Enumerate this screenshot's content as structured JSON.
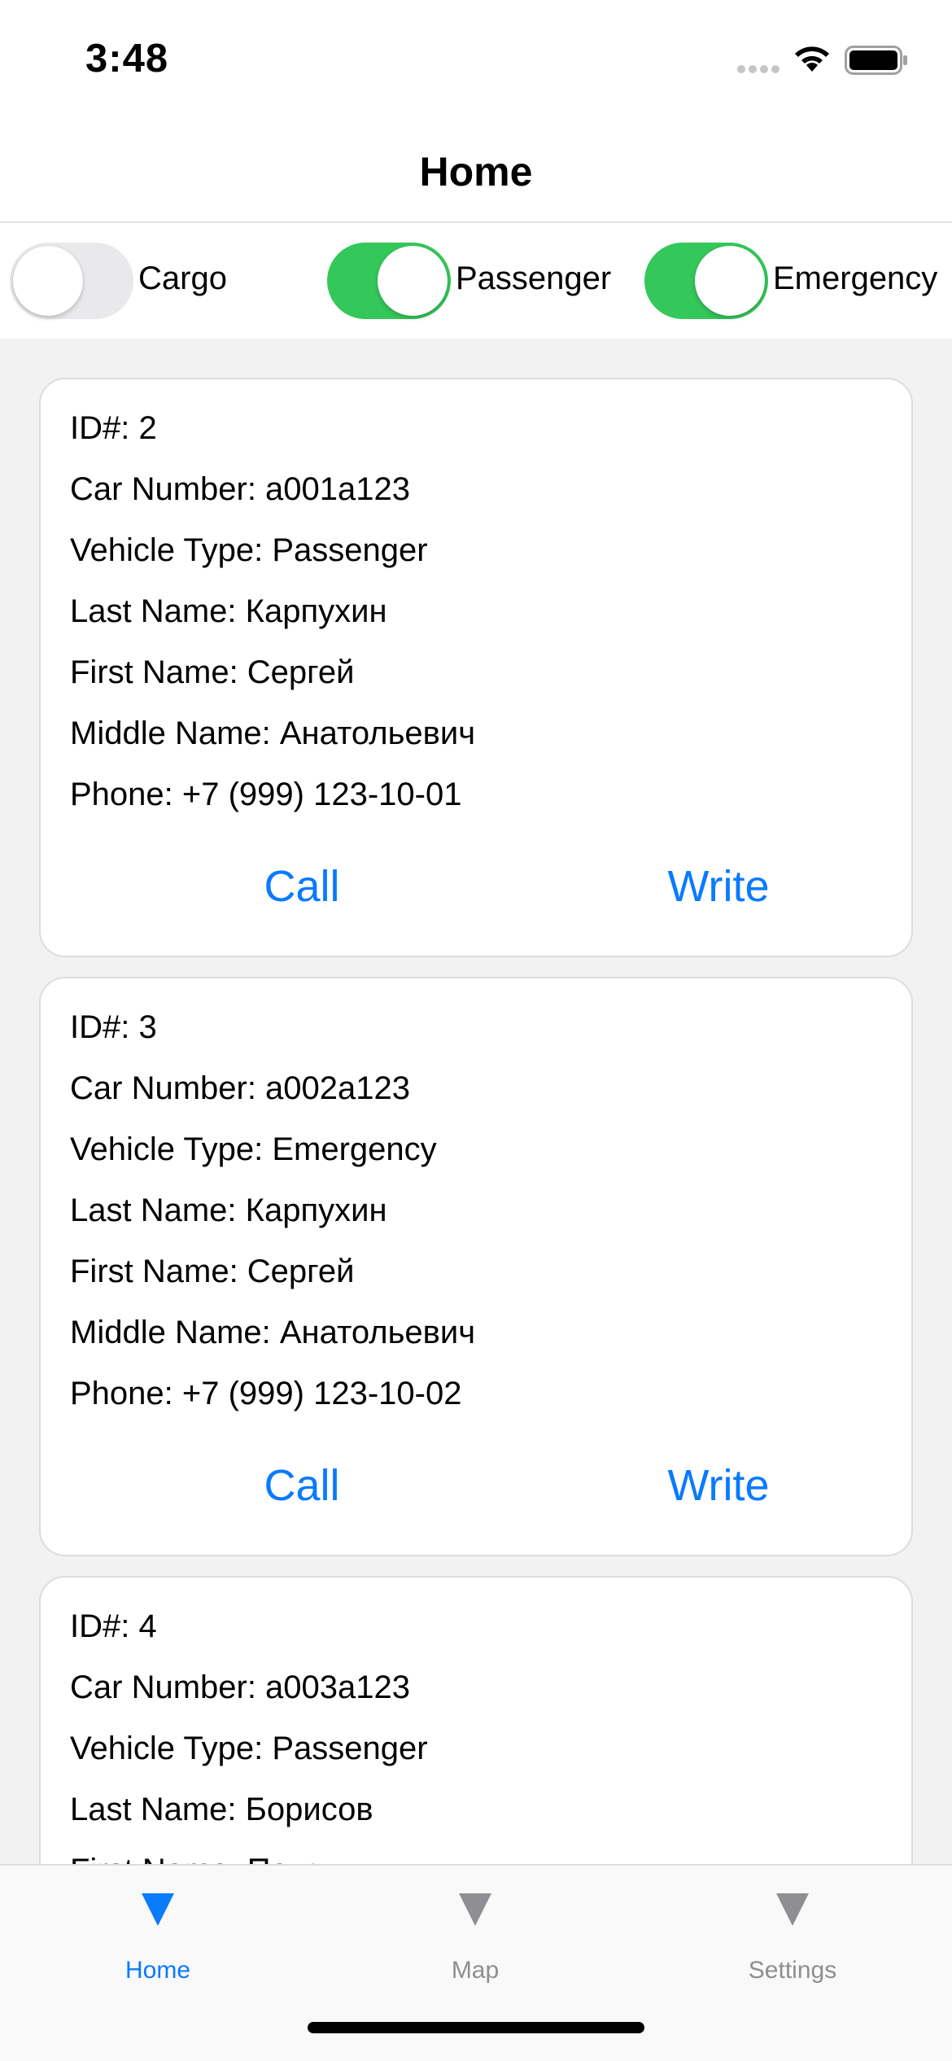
{
  "status_bar": {
    "time": "3:48"
  },
  "navbar": {
    "title": "Home"
  },
  "filters": [
    {
      "label": "Cargo",
      "on": false
    },
    {
      "label": "Passenger",
      "on": true
    },
    {
      "label": "Emergency",
      "on": true
    }
  ],
  "cards": [
    {
      "id": "ID#: 2",
      "car_number": "Car Number: a001a123",
      "vehicle_type": "Vehicle Type: Passenger",
      "last_name": "Last Name: Карпухин",
      "first_name": "First Name: Сергей",
      "middle_name": "Middle Name: Анатольевич",
      "phone": "Phone: +7 (999) 123-10-01",
      "call_label": "Call",
      "write_label": "Write"
    },
    {
      "id": "ID#: 3",
      "car_number": "Car Number: a002a123",
      "vehicle_type": "Vehicle Type: Emergency",
      "last_name": "Last Name: Карпухин",
      "first_name": "First Name: Сергей",
      "middle_name": "Middle Name: Анатольевич",
      "phone": "Phone: +7 (999) 123-10-02",
      "call_label": "Call",
      "write_label": "Write"
    },
    {
      "id": "ID#: 4",
      "car_number": "Car Number: a003a123",
      "vehicle_type": "Vehicle Type: Passenger",
      "last_name": "Last Name: Борисов",
      "first_name": "First Name: Петр"
    }
  ],
  "tabs": [
    {
      "label": "Home",
      "active": true
    },
    {
      "label": "Map",
      "active": false
    },
    {
      "label": "Settings",
      "active": false
    }
  ],
  "colors": {
    "accent": "#0a7aff",
    "switch_on": "#34c759",
    "switch_off": "#e9e9eb",
    "background": "#f2f2f2"
  },
  "icons": {
    "tab_home": "triangle-icon",
    "tab_map": "triangle-icon",
    "tab_settings": "triangle-icon"
  }
}
